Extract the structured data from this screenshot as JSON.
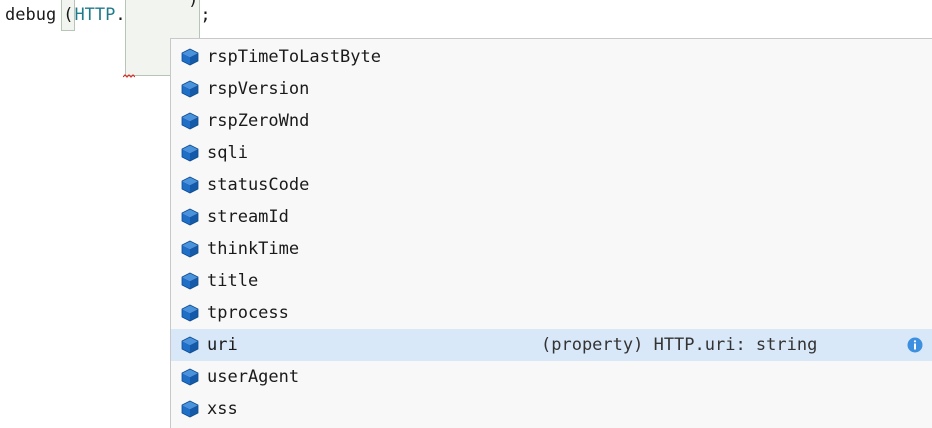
{
  "editor": {
    "function_name": "debug",
    "open_paren": "(",
    "namespace": "HTTP",
    "dot": ".",
    "close_paren": ")",
    "semicolon": ";"
  },
  "suggestions": {
    "items": [
      {
        "label": "rspTimeToLastByte",
        "icon": "property-icon"
      },
      {
        "label": "rspVersion",
        "icon": "property-icon"
      },
      {
        "label": "rspZeroWnd",
        "icon": "property-icon"
      },
      {
        "label": "sqli",
        "icon": "property-icon"
      },
      {
        "label": "statusCode",
        "icon": "property-icon"
      },
      {
        "label": "streamId",
        "icon": "property-icon"
      },
      {
        "label": "thinkTime",
        "icon": "property-icon"
      },
      {
        "label": "title",
        "icon": "property-icon"
      },
      {
        "label": "tprocess",
        "icon": "property-icon"
      },
      {
        "label": "uri",
        "icon": "property-icon",
        "detail": "(property) HTTP.uri: string",
        "selected": true
      },
      {
        "label": "userAgent",
        "icon": "property-icon"
      },
      {
        "label": "xss",
        "icon": "property-icon"
      }
    ],
    "colors": {
      "icon_fill": "#1f6fc9",
      "selected_bg": "#d9e8f8",
      "info_icon": "#3d8fe0"
    }
  }
}
